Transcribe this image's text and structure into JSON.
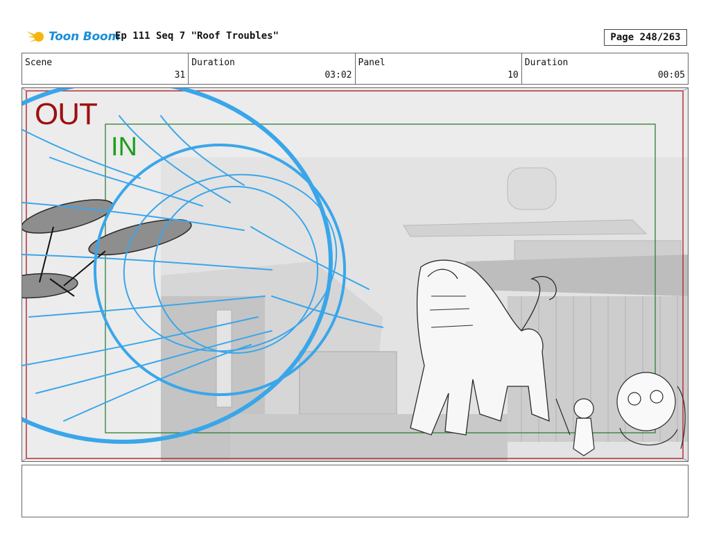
{
  "header": {
    "logo_text": "Toon Boom",
    "title": "Ep 111 Seq 7 \"Roof Troubles\"",
    "page": "Page 248/263"
  },
  "info": {
    "scene_label": "Scene",
    "scene_value": "31",
    "duration_label": "Duration",
    "duration_value": "03:02",
    "panel_label": "Panel",
    "panel_value": "10",
    "panel_duration_label": "Duration",
    "panel_duration_value": "00:05"
  },
  "panel": {
    "out_label": "OUT",
    "in_label": "IN"
  },
  "colors": {
    "out_frame": "#b5303a",
    "in_frame": "#2e7d32",
    "effect_blue": "#3aa6ea",
    "logo_blue": "#1b8fd6",
    "logo_yellow": "#f5b50a"
  }
}
